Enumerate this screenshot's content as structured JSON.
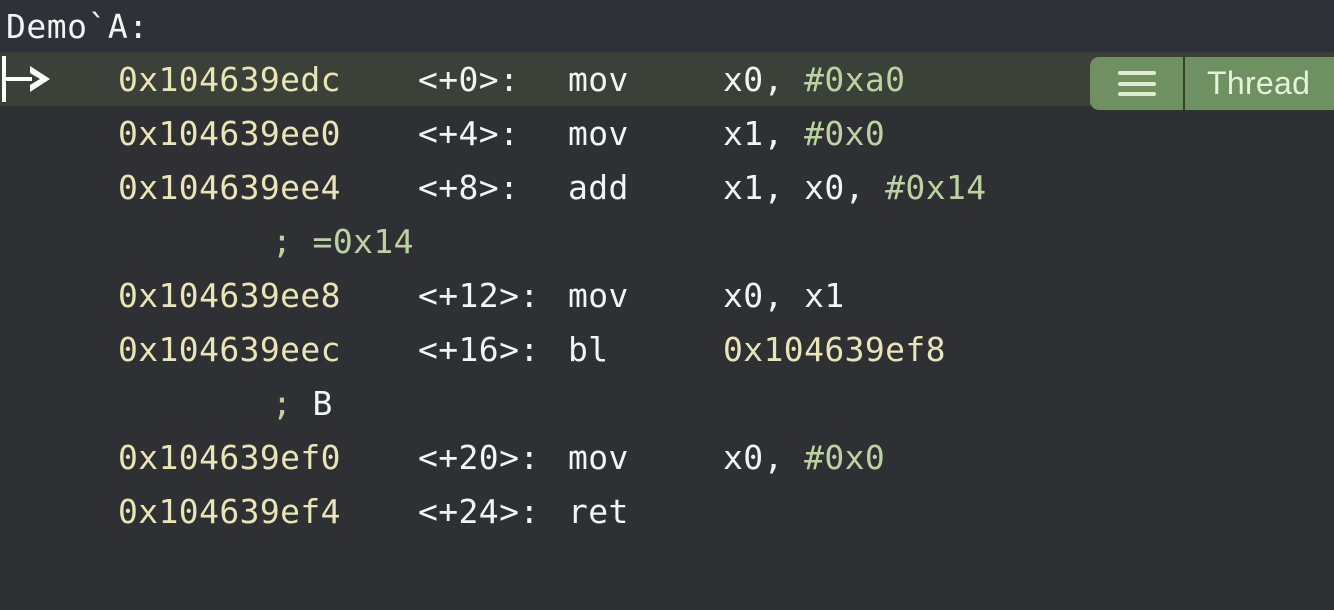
{
  "window": {
    "symbol_header": "Demo`A:",
    "background": "#2e3033",
    "current_line_background": "#3b4139",
    "address_color": "#e9e5b4",
    "immediate_color": "#bcd3a0",
    "text_color": "#f4f4f4",
    "accent_green": "#6f9161"
  },
  "thread_widget": {
    "menu_icon": "hamburger-icon",
    "label": "Thread"
  },
  "disassembly": {
    "marker": "|->",
    "lines": [
      {
        "current": true,
        "address": "0x104639edc",
        "offset": "<+0>:",
        "mnemonic": "mov",
        "operands": [
          {
            "text": "x0, ",
            "kind": "reg"
          },
          {
            "text": "#0xa0",
            "kind": "imm"
          }
        ]
      },
      {
        "current": false,
        "address": "0x104639ee0",
        "offset": "<+4>:",
        "mnemonic": "mov",
        "operands": [
          {
            "text": "x1, ",
            "kind": "reg"
          },
          {
            "text": "#0x0",
            "kind": "imm"
          }
        ]
      },
      {
        "current": false,
        "address": "0x104639ee4",
        "offset": "<+8>:",
        "mnemonic": "add",
        "operands": [
          {
            "text": "x1, x0, ",
            "kind": "reg"
          },
          {
            "text": "#0x14",
            "kind": "imm"
          }
        ],
        "comment": {
          "semi": ";",
          "value": " =0x14",
          "kind": "val"
        }
      },
      {
        "current": false,
        "address": "0x104639ee8",
        "offset": "<+12>:",
        "mnemonic": "mov",
        "operands": [
          {
            "text": "x0, x1",
            "kind": "reg"
          }
        ]
      },
      {
        "current": false,
        "address": "0x104639eec",
        "offset": "<+16>:",
        "mnemonic": "bl",
        "operands": [
          {
            "text": "0x104639ef8",
            "kind": "target"
          }
        ],
        "comment": {
          "semi": ";",
          "value": " B",
          "kind": "sym"
        }
      },
      {
        "current": false,
        "address": "0x104639ef0",
        "offset": "<+20>:",
        "mnemonic": "mov",
        "operands": [
          {
            "text": "x0, ",
            "kind": "reg"
          },
          {
            "text": "#0x0",
            "kind": "imm"
          }
        ]
      },
      {
        "current": false,
        "address": "0x104639ef4",
        "offset": "<+24>:",
        "mnemonic": "ret",
        "operands": []
      }
    ]
  }
}
